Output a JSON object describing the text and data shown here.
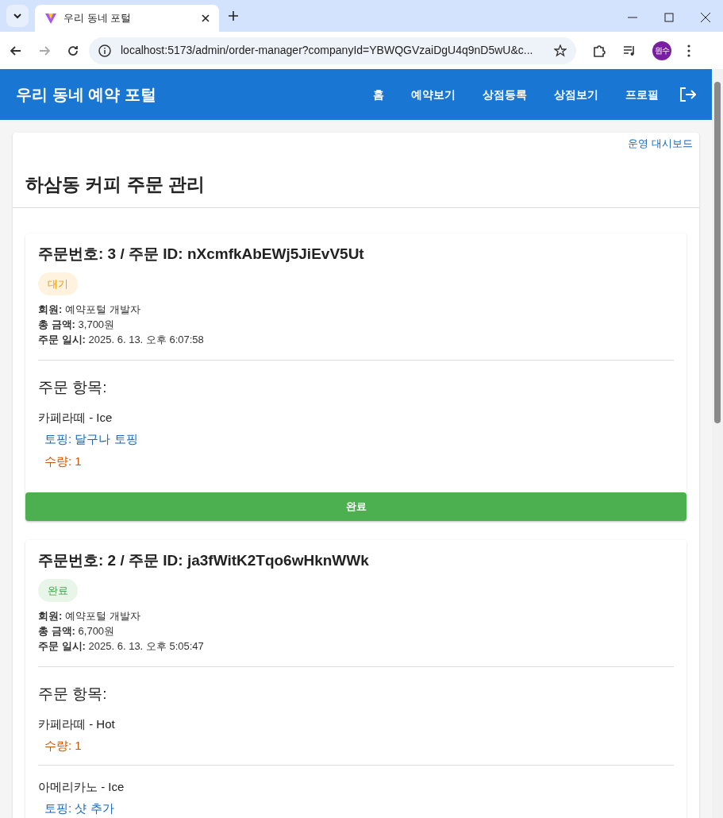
{
  "browser": {
    "tab_title": "우리 동네 포털",
    "url": "localhost:5173/admin/order-manager?companyId=YBWQGVzaiDgU4q9nD5wU&c...",
    "profile": "원수"
  },
  "app_bar": {
    "title": "우리 동네 예약 포털",
    "nav": [
      {
        "label": "홈"
      },
      {
        "label": "예약보기"
      },
      {
        "label": "상점등록"
      },
      {
        "label": "상점보기"
      },
      {
        "label": "프로필"
      }
    ]
  },
  "dashboard_link": "운영 대시보드",
  "page_title": "하삼동 커피 주문 관리",
  "orders": [
    {
      "title": "주문번호: 3 / 주문 ID: nXcmfkAbEWj5JiEvV5Ut",
      "status": {
        "label": "대기",
        "kind": "pending"
      },
      "details": [
        "**회원:** 예약포털 개발자",
        "**총 금액:** 3,700원",
        "**주문 일시:** 2025. 6. 13. 오후 6:07:58"
      ],
      "items_heading": "주문 항목:",
      "items": [
        {
          "name": "카페라떼 - Ice",
          "topping": "토핑: 달구나 토핑",
          "quantity": "수량: 1"
        }
      ],
      "action": "완료"
    },
    {
      "title": "주문번호: 2 / 주문 ID: ja3fWitK2Tqo6wHknWWk",
      "status": {
        "label": "완료",
        "kind": "done"
      },
      "details": [
        "**회원:** 예약포털 개발자",
        "**총 금액:** 6,700원",
        "**주문 일시:** 2025. 6. 13. 오후 5:05:47"
      ],
      "items_heading": "주문 항목:",
      "items": [
        {
          "name": "카페라떼 - Hot",
          "quantity": "수량: 1"
        },
        {
          "name": "아메리카노 - Ice",
          "topping": "토핑: 샷 추가"
        }
      ]
    }
  ]
}
